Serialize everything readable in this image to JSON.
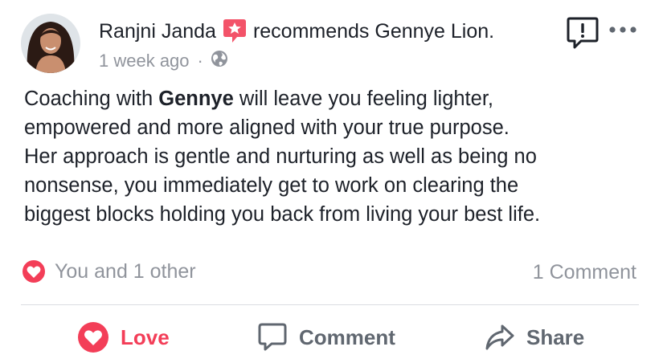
{
  "post": {
    "author": "Ranjni Janda",
    "verb": "recommends Gennye Lion.",
    "timestamp": "1 week ago",
    "separator": "·",
    "audience_icon": "globe-icon",
    "body": {
      "line1_pre": "Coaching with ",
      "line1_bold": "Gennye",
      "line1_post": " will leave you feeling lighter,",
      "line2": "empowered and more aligned with your true purpose.",
      "line3": "Her approach is gentle and nurturing as well as being no",
      "line4": "nonsense, you immediately get to work on clearing the",
      "line5": "biggest blocks holding you back from living your best life."
    }
  },
  "summary": {
    "reactions_text": "You and 1 other",
    "reaction_icon": "love-reaction-icon",
    "comments_text": "1 Comment"
  },
  "actions": {
    "love_label": "Love",
    "comment_label": "Comment",
    "share_label": "Share"
  },
  "colors": {
    "love": "#f33e58",
    "muted": "#90949c",
    "text": "#1d2129",
    "action_gray": "#606770",
    "divider": "#dadde1"
  }
}
